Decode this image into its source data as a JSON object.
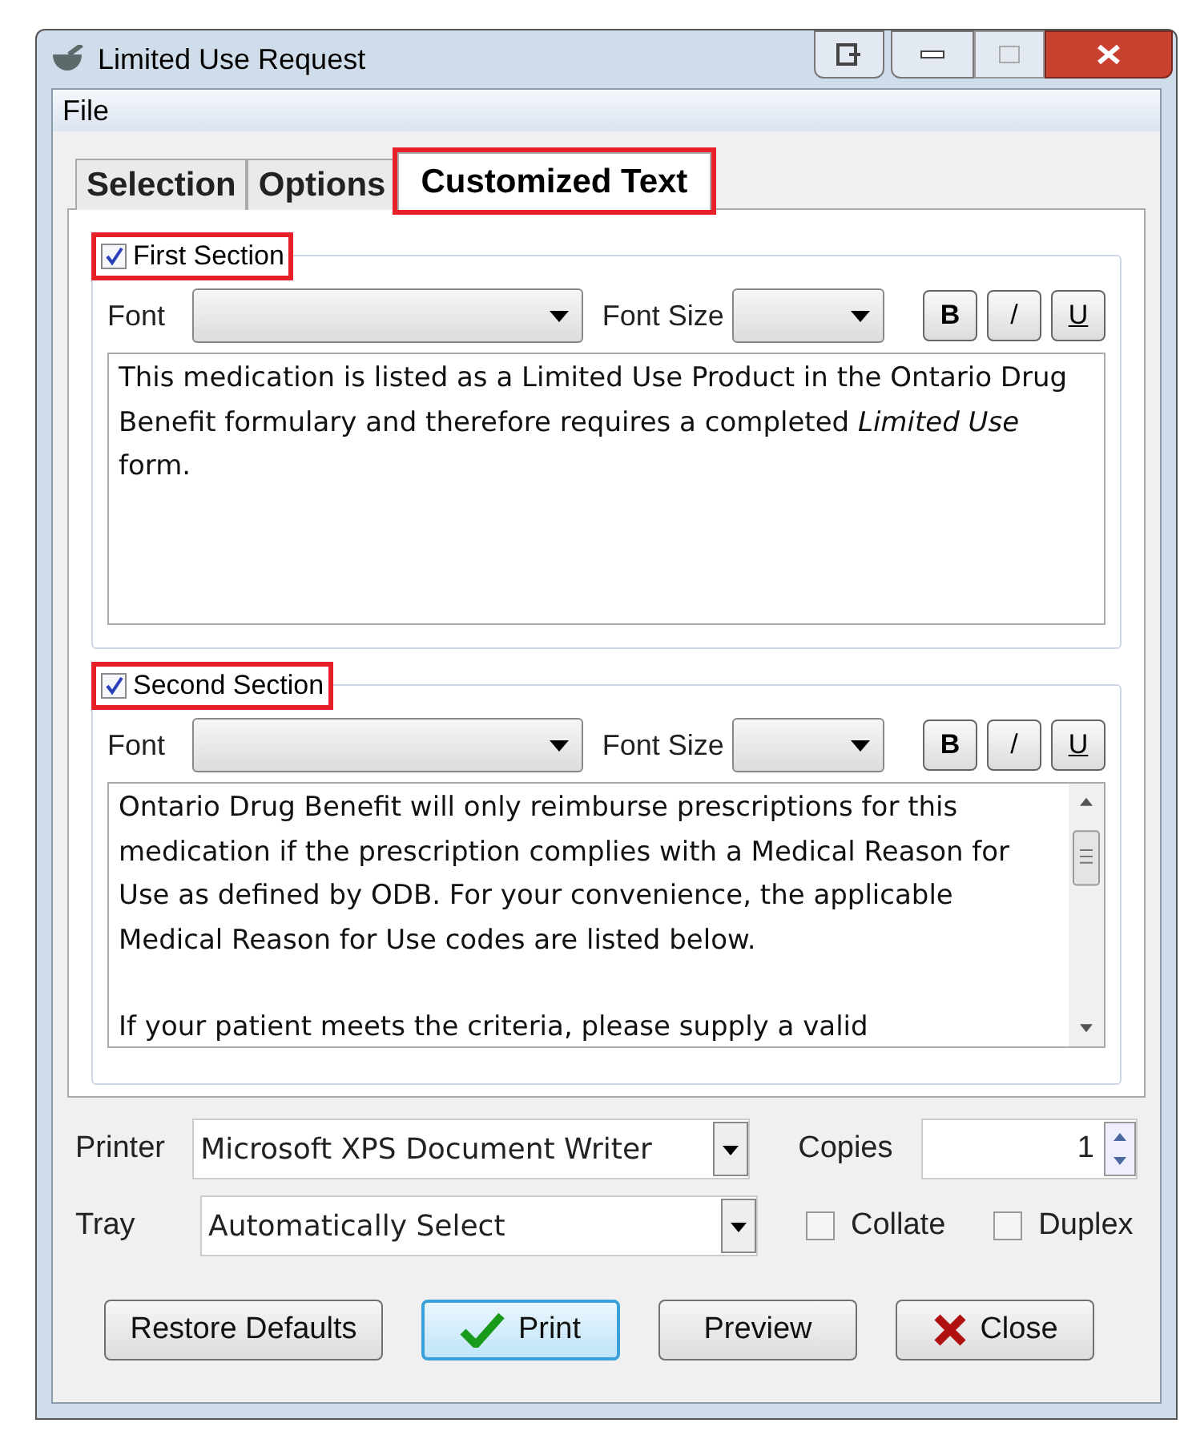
{
  "window": {
    "title": "Limited Use Request"
  },
  "menu": [
    "File"
  ],
  "tabs": [
    {
      "label": "Selection",
      "selected": false,
      "highlighted": false
    },
    {
      "label": "Options",
      "selected": false,
      "highlighted": false
    },
    {
      "label": "Customized Text",
      "selected": true,
      "highlighted": true
    }
  ],
  "sections": [
    {
      "title": "First Section",
      "checked": true,
      "highlighted": true,
      "font_label": "Font",
      "font_size_label": "Font Size",
      "format_buttons": [
        "B",
        "/",
        "U"
      ],
      "scrollbar": false,
      "paragraphs": [
        "This medication is listed as a Limited Use Product in the Ontario Drug Benefit formulary and therefore requires a completed *Limited Use* form."
      ]
    },
    {
      "title": "Second Section",
      "checked": true,
      "highlighted": true,
      "font_label": "Font",
      "font_size_label": "Font Size",
      "format_buttons": [
        "B",
        "/",
        "U"
      ],
      "scrollbar": true,
      "paragraphs": [
        "Ontario Drug Benefit will only reimburse prescriptions for this medication if the prescription complies with a Medical Reason for Use as defined by ODB. For your convenience, the applicable Medical Reason for Use codes are listed below.",
        "If your patient meets the criteria, please supply a valid"
      ]
    }
  ],
  "printer": {
    "label": "Printer",
    "value": "Microsoft XPS Document Writer"
  },
  "tray": {
    "label": "Tray",
    "value": "Automatically Select"
  },
  "copies": {
    "label": "Copies",
    "value": "1"
  },
  "options": [
    {
      "label": "Collate",
      "checked": false
    },
    {
      "label": "Duplex",
      "checked": false
    }
  ],
  "buttons": [
    {
      "label": "Restore Defaults",
      "kind": "plain",
      "default": false
    },
    {
      "label": "Print",
      "kind": "check",
      "default": true
    },
    {
      "label": "Preview",
      "kind": "plain",
      "default": false
    },
    {
      "label": "Close",
      "kind": "cross",
      "default": false
    }
  ]
}
